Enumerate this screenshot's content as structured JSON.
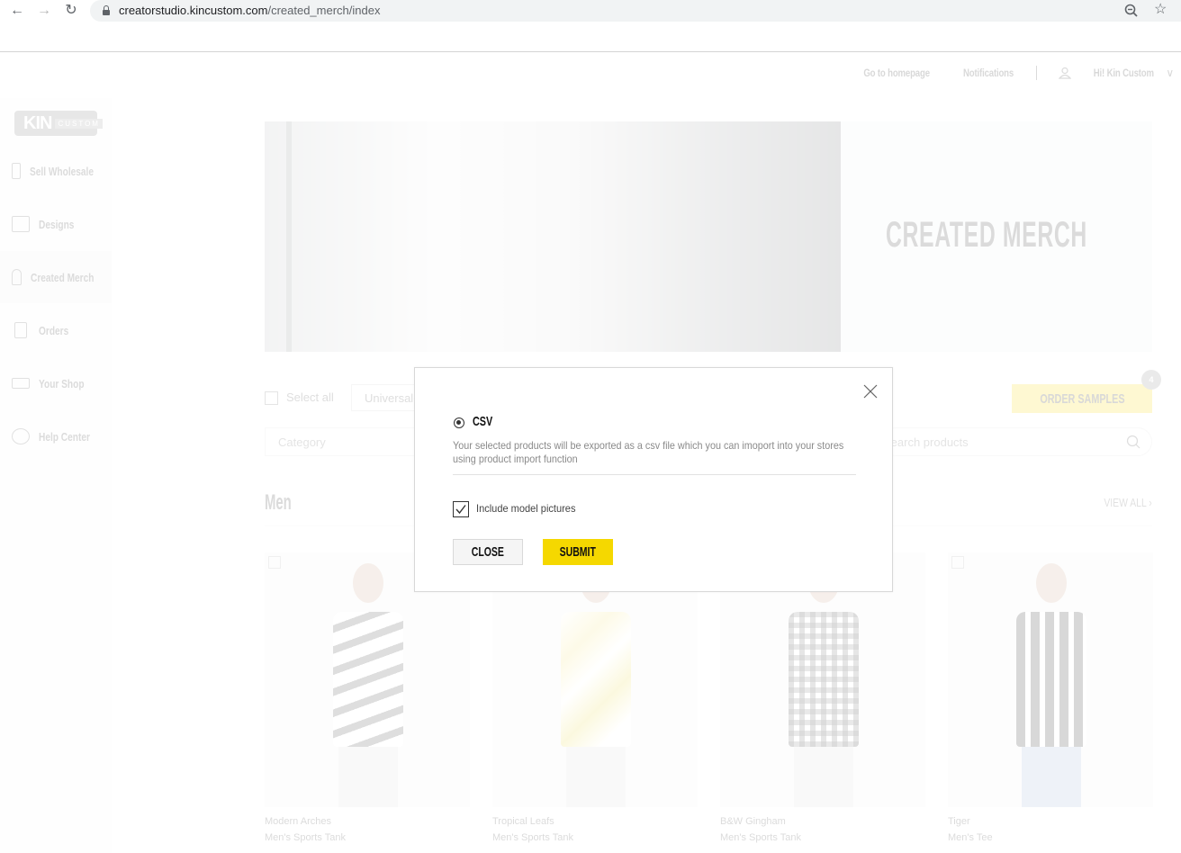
{
  "browser": {
    "url_host": "creatorstudio.kincustom.com",
    "url_path": "/created_merch/index",
    "icons": [
      "back-arrow-icon",
      "forward-arrow-icon",
      "reload-icon",
      "lock-icon",
      "zoom-out-icon",
      "bookmark-star-icon"
    ]
  },
  "topbar": {
    "homepage": "Go to homepage",
    "notifications": "Notifications",
    "greeting": "Hi! Kin Custom"
  },
  "logo": {
    "kin": "KIN",
    "custom": "CUSTOM"
  },
  "sidebar": {
    "items": [
      {
        "label": "Sell Wholesale",
        "icon": "storefront-icon",
        "active": false
      },
      {
        "label": "Designs",
        "icon": "monitor-icon",
        "active": false
      },
      {
        "label": "Created Merch",
        "icon": "tshirt-icon",
        "active": true
      },
      {
        "label": "Orders",
        "icon": "receipt-icon",
        "active": false
      },
      {
        "label": "Your Shop",
        "icon": "open-sign-icon",
        "active": false
      },
      {
        "label": "Help Center",
        "icon": "help-chat-icon",
        "active": false
      }
    ]
  },
  "hero": {
    "title": "CREATED MERCH"
  },
  "toolbar": {
    "select_all": "Select all",
    "universal": "Universal(",
    "order_samples": "ORDER SAMPLES",
    "order_badge": "4",
    "category_placeholder": "Category",
    "search_placeholder": "Search products"
  },
  "section": {
    "title": "Men",
    "view_all": "VIEW ALL"
  },
  "products": [
    {
      "name": "Modern Arches",
      "type": "Men's Sports Tank",
      "checked": true
    },
    {
      "name": "Tropical Leafs",
      "type": "Men's Sports Tank",
      "checked": false
    },
    {
      "name": "B&W Gingham",
      "type": "Men's Sports Tank",
      "checked": false
    },
    {
      "name": "Tiger",
      "type": "Men's Tee",
      "checked": true
    }
  ],
  "modal": {
    "option_label": "CSV",
    "option_selected": true,
    "description": "Your selected products will be exported as a csv file which you can imoport into your stores using product import function",
    "checkbox_label": "Include model pictures",
    "checkbox_checked": true,
    "close_label": "CLOSE",
    "submit_label": "SUBMIT",
    "submit_color": "#f5d800"
  }
}
